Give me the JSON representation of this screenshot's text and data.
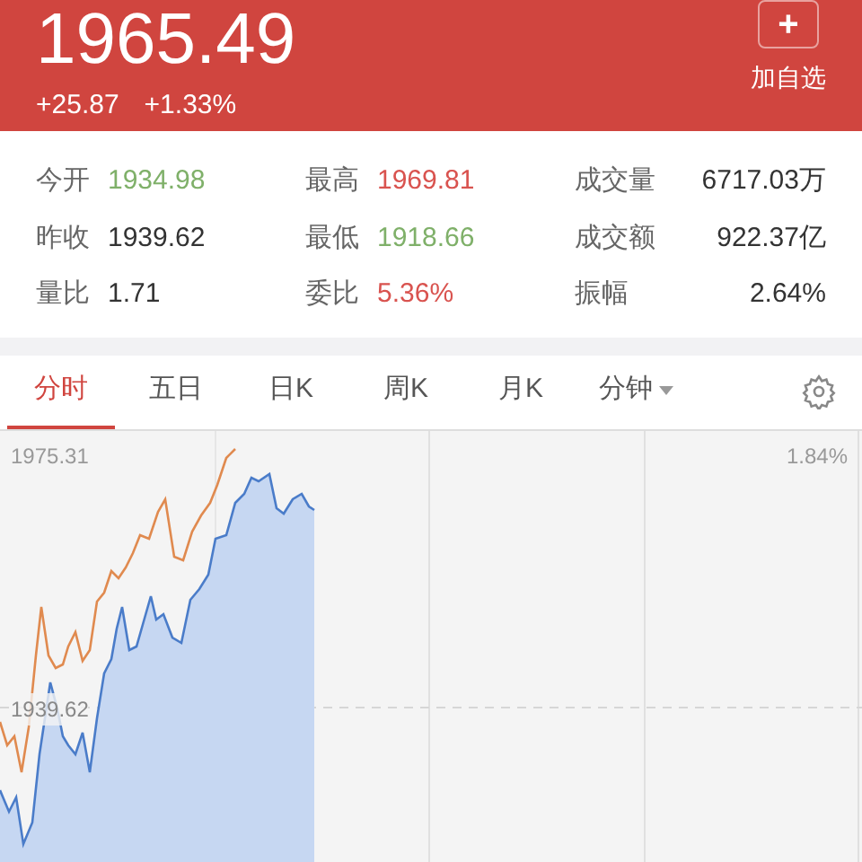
{
  "header": {
    "price": "1965.49",
    "change": "+25.87",
    "change_pct": "+1.33%",
    "add_button": {
      "icon": "+",
      "label": "加自选"
    }
  },
  "stats": [
    {
      "label": "今开",
      "value": "1934.98",
      "color": "#7fb069"
    },
    {
      "label": "最高",
      "value": "1969.81",
      "color": "#d9534f"
    },
    {
      "label": "成交量",
      "value": "6717.03万",
      "color": "#333333"
    },
    {
      "label": "昨收",
      "value": "1939.62",
      "color": "#333333"
    },
    {
      "label": "最低",
      "value": "1918.66",
      "color": "#7fb069"
    },
    {
      "label": "成交额",
      "value": "922.37亿",
      "color": "#333333"
    },
    {
      "label": "量比",
      "value": "1.71",
      "color": "#333333"
    },
    {
      "label": "委比",
      "value": "5.36%",
      "color": "#d9534f"
    },
    {
      "label": "振幅",
      "value": "2.64%",
      "color": "#333333"
    }
  ],
  "tabs": [
    {
      "label": "分时",
      "selected": true,
      "dropdown": false
    },
    {
      "label": "五日",
      "selected": false,
      "dropdown": false
    },
    {
      "label": "日K",
      "selected": false,
      "dropdown": false
    },
    {
      "label": "周K",
      "selected": false,
      "dropdown": false
    },
    {
      "label": "月K",
      "selected": false,
      "dropdown": false
    },
    {
      "label": "分钟",
      "selected": false,
      "dropdown": true
    }
  ],
  "chart": {
    "top_label": "1975.31",
    "mid_label": "1939.62",
    "right_label": "1.84%"
  }
}
